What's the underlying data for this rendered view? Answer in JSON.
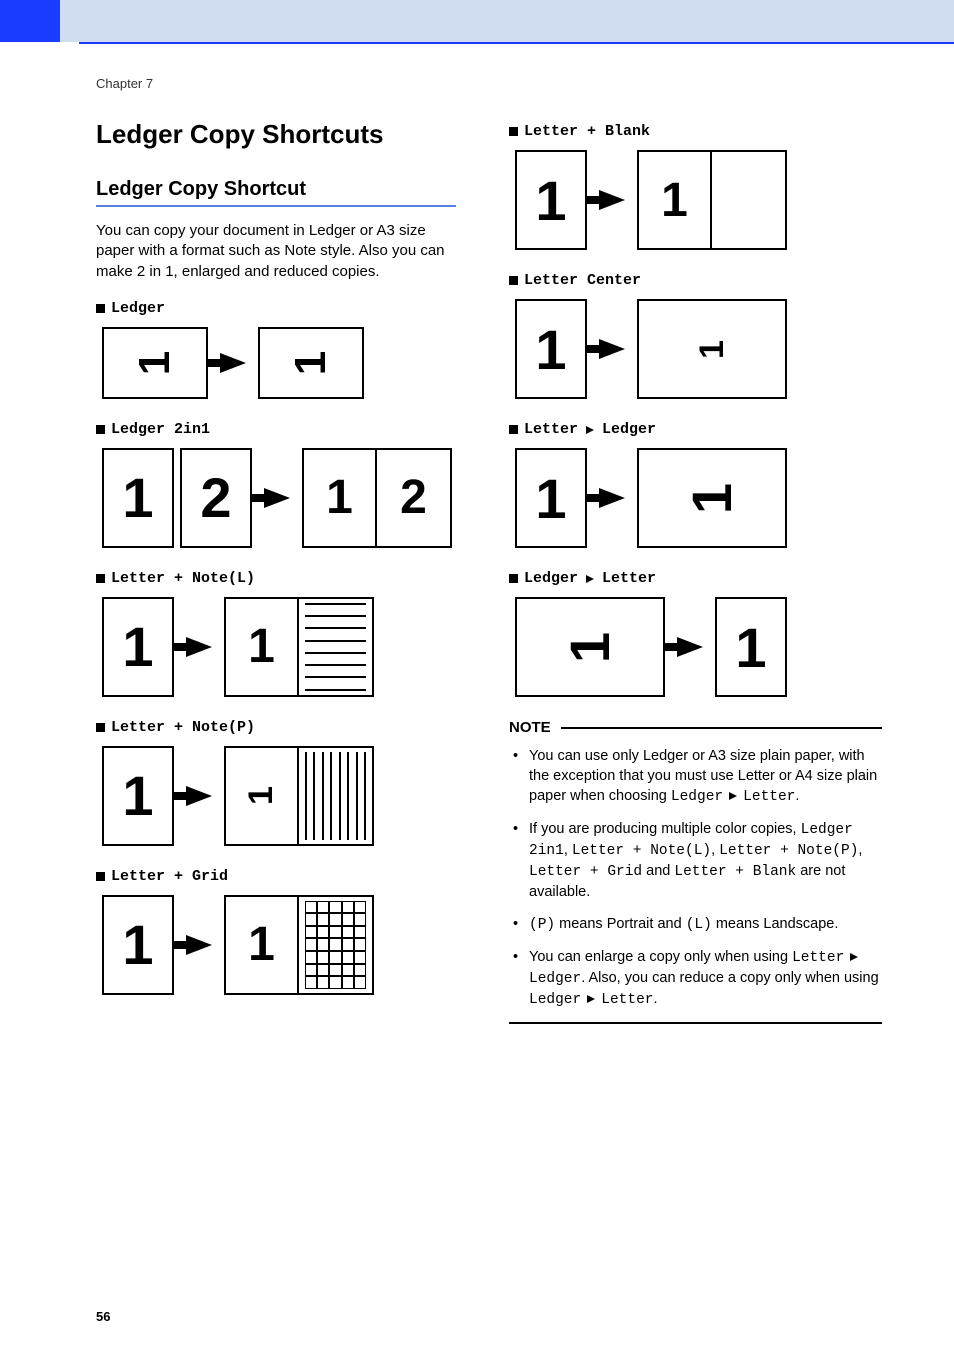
{
  "header": {
    "chapter": "Chapter 7"
  },
  "title": "Ledger Copy Shortcuts",
  "subtitle": "Ledger Copy Shortcut",
  "intro": "You can copy your document in Ledger or A3 size paper with a format such as Note style. Also you can make 2 in 1, enlarged and reduced copies.",
  "items": {
    "ledger": "Ledger",
    "ledger2in1": "Ledger 2in1",
    "noteL": "Letter + Note(L)",
    "noteP": "Letter + Note(P)",
    "grid": "Letter + Grid",
    "blank": "Letter + Blank",
    "center": "Letter Center",
    "letter_to_ledger_a": "Letter",
    "letter_to_ledger_b": "Ledger",
    "ledger_to_letter_a": "Ledger",
    "ledger_to_letter_b": "Letter"
  },
  "note": {
    "title": "NOTE",
    "li1a": "You can use only Ledger or A3 size plain paper, with the exception that you must use Letter or A4 size plain paper when choosing ",
    "li1b_a": "Ledger",
    "li1b_b": "Letter",
    "li1c": ".",
    "li2a": "If you are producing multiple color copies, ",
    "li2b": "Ledger 2in1",
    "li2c": ", ",
    "li2d": "Letter + Note(L)",
    "li2e": ", ",
    "li2f": "Letter + Note(P)",
    "li2g": ", ",
    "li2h": "Letter + Grid",
    "li2i": " and ",
    "li2j": "Letter + Blank",
    "li2k": " are not available.",
    "li3a": "(P)",
    "li3b": " means Portrait and ",
    "li3c": "(L)",
    "li3d": " means Landscape.",
    "li4a": "You can enlarge a copy only when using ",
    "li4b_a": "Letter",
    "li4b_b": "Ledger",
    "li4c": ". Also, you can reduce a copy only when using ",
    "li4d_a": "Ledger",
    "li4d_b": "Letter",
    "li4e": "."
  },
  "glyphs": {
    "one": "1",
    "two": "2"
  },
  "page_number": "56"
}
